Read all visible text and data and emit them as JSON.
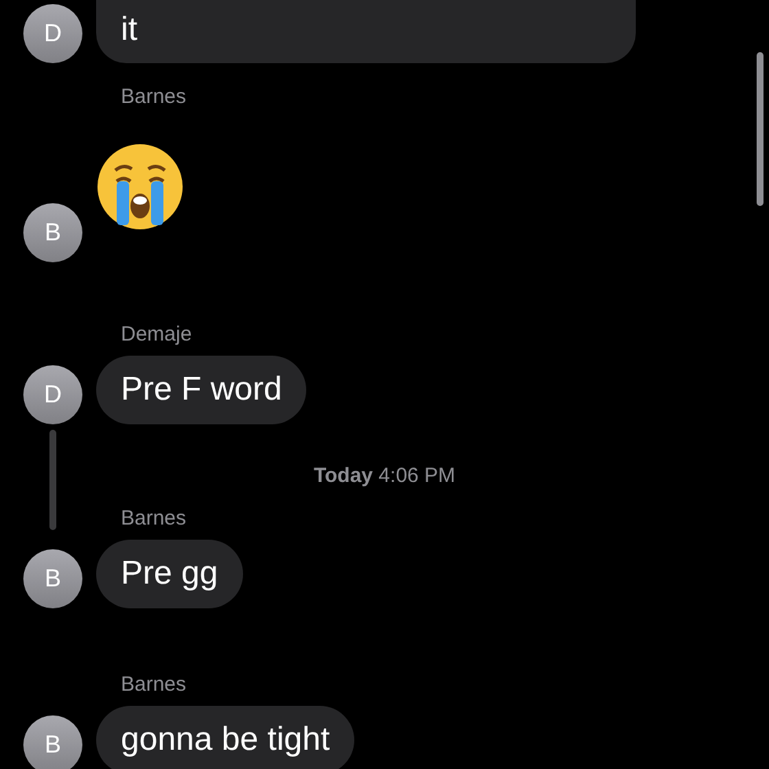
{
  "messages": [
    {
      "kind": "text_cut",
      "avatar": "D",
      "text": "it"
    },
    {
      "kind": "emoji",
      "sender": "Barnes",
      "avatar": "B"
    },
    {
      "kind": "text",
      "sender": "Demaje",
      "avatar": "D",
      "text": "Pre F word"
    },
    {
      "kind": "timestamp",
      "text": "**Today** 4:06 PM"
    },
    {
      "kind": "text",
      "sender": "Barnes",
      "avatar": "B",
      "text": "Pre gg"
    },
    {
      "kind": "text",
      "sender": "Barnes",
      "avatar": "B",
      "text": "gonna be tight"
    }
  ]
}
